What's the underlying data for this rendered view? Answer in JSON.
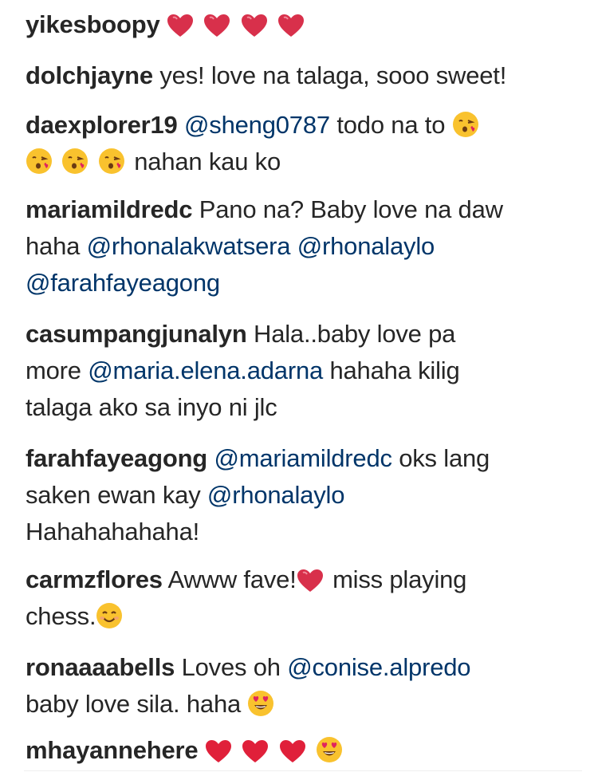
{
  "comments": [
    {
      "username": "yikesboopy",
      "parts": [],
      "trailing_emojis": [
        "heart-icon",
        "heart-icon",
        "heart-icon",
        "heart-icon"
      ]
    },
    {
      "username": "dolchjayne",
      "text": "yes! love na talaga, sooo sweet!"
    },
    {
      "username": "daexplorer19",
      "mention": "@sheng0787",
      "text_1": "todo na to",
      "text_2": "nahan kau ko",
      "emojis": [
        "face-blowing-kiss-icon",
        "face-blowing-kiss-icon",
        "face-blowing-kiss-icon",
        "face-blowing-kiss-icon"
      ]
    },
    {
      "username": "mariamildredc",
      "text_1": "Pano na? Baby love na daw",
      "text_2": "haha",
      "mention_1": "@rhonalakwatsera",
      "mention_2": "@rhonalaylo",
      "mention_3": "@farahfayeagong"
    },
    {
      "username": "casumpangjunalyn",
      "text_1": "Hala..baby love pa",
      "text_2": "more",
      "mention_1": "@maria.elena.adarna",
      "text_3": "hahaha kilig",
      "text_4": "talaga ako sa inyo ni jlc"
    },
    {
      "username": "farahfayeagong",
      "mention_1": "@mariamildredc",
      "text_1": "oks lang",
      "text_2": "saken ewan kay",
      "mention_2": "@rhonalaylo",
      "text_3": "Hahahahahaha!"
    },
    {
      "username": "carmzflores",
      "text_1": "Awww fave!",
      "text_2": "miss playing",
      "text_3": "chess."
    },
    {
      "username": "ronaaaabells",
      "text_1": "Loves oh",
      "mention_1": "@conise.alpredo",
      "text_2": "baby love sila. haha"
    },
    {
      "username": "mhayannehere"
    }
  ],
  "colors": {
    "text": "#262626",
    "mention": "#003569",
    "heart": "#e0245e",
    "emoji_face": "#f9c22e"
  }
}
